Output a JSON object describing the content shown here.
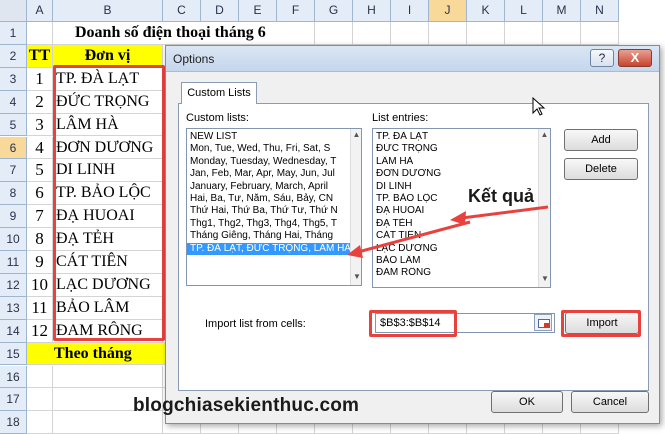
{
  "columns": [
    "A",
    "B",
    "C",
    "D",
    "E",
    "F",
    "G",
    "H",
    "I",
    "J",
    "K",
    "L",
    "M",
    "N"
  ],
  "selected_column": "J",
  "rows": [
    "1",
    "2",
    "3",
    "4",
    "5",
    "6",
    "7",
    "8",
    "9",
    "10",
    "11",
    "12",
    "13",
    "14",
    "15",
    "16",
    "17",
    "18"
  ],
  "selected_row": "6",
  "sheet": {
    "title": "Doanh số điện thoại tháng 6",
    "header_tt": "TT",
    "header_unit": "Đơn vị",
    "entries": [
      {
        "tt": "1",
        "name": "TP. ĐÀ LẠT"
      },
      {
        "tt": "2",
        "name": "ĐỨC TRỌNG"
      },
      {
        "tt": "3",
        "name": "LÂM HÀ"
      },
      {
        "tt": "4",
        "name": "ĐƠN DƯƠNG"
      },
      {
        "tt": "5",
        "name": "DI LINH"
      },
      {
        "tt": "6",
        "name": "TP. BẢO LỘC"
      },
      {
        "tt": "7",
        "name": "ĐẠ HUOAI"
      },
      {
        "tt": "8",
        "name": "ĐẠ TẺH"
      },
      {
        "tt": "9",
        "name": "CÁT TIÊN"
      },
      {
        "tt": "10",
        "name": "LẠC DƯƠNG"
      },
      {
        "tt": "11",
        "name": "BẢO LÂM"
      },
      {
        "tt": "12",
        "name": "ĐAM RÔNG"
      }
    ],
    "footer": "Theo tháng"
  },
  "dialog": {
    "title": "Options",
    "help_button": "?",
    "close_button": "X",
    "tab": "Custom Lists",
    "custom_lists_label": "Custom lists:",
    "custom_lists": [
      "NEW LIST",
      "Mon, Tue, Wed, Thu, Fri, Sat, S",
      "Monday, Tuesday, Wednesday, T",
      "Jan, Feb, Mar, Apr, May, Jun, Jul",
      "January, February, March, April",
      "Hai, Ba, Tư, Năm, Sáu, Bảy, CN",
      "Thứ Hai, Thứ Ba, Thứ Tư, Thứ N",
      "Thg1, Thg2, Thg3, Thg4, Thg5, T",
      "Tháng Giêng, Tháng Hai, Tháng",
      "TP. ĐÀ LẠT, ĐỨC TRỌNG, LÂM HÀ,"
    ],
    "selected_list_index": 9,
    "list_entries_label": "List entries:",
    "list_entries": [
      "TP. ĐÀ LẠT",
      "ĐỨC TRỌNG",
      "LÂM HÀ",
      "ĐƠN DƯƠNG",
      "DI LINH",
      "TP. BẢO LỘC",
      "ĐẠ HUOAI",
      "ĐẠ TẺH",
      "CÁT TIÊN",
      "LẠC DƯƠNG",
      "BẢO LÂM",
      "ĐAM RÔNG"
    ],
    "add_button": "Add",
    "delete_button": "Delete",
    "import_label": "Import list from cells:",
    "import_range": "$B$3:$B$14",
    "import_button": "Import",
    "ok_button": "OK",
    "cancel_button": "Cancel"
  },
  "annotation": "Kết quả",
  "watermark": "blogchiasekienthuc.com",
  "colors": {
    "highlight": "#ffff00",
    "annotation_red": "#e8423e",
    "selection_blue": "#3399ff"
  }
}
